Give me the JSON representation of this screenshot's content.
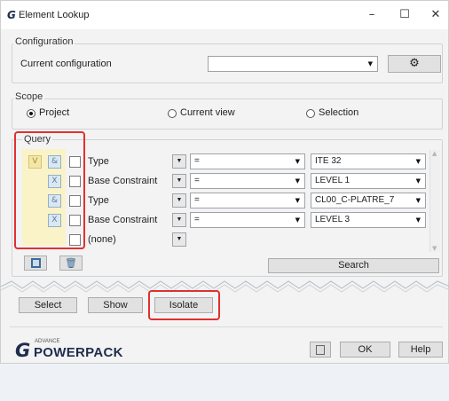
{
  "window": {
    "title": "Element Lookup",
    "app_icon": "g-logo-icon",
    "controls": {
      "minimize": "–",
      "maximize": "☐",
      "close": "✕"
    }
  },
  "configuration": {
    "group_label": "Configuration",
    "current_label": "Current configuration",
    "current_value": "",
    "settings_icon": "gear-icon"
  },
  "scope": {
    "group_label": "Scope",
    "options": [
      "Project",
      "Current view",
      "Selection"
    ],
    "selected": "Project"
  },
  "query": {
    "group_label": "Query",
    "rows": [
      {
        "op": "V",
        "op2": "&",
        "param": "Type",
        "operator": "=",
        "value": "ITE 32"
      },
      {
        "op": "",
        "op2": "X",
        "param": "Base Constraint",
        "operator": "=",
        "value": "LEVEL 1"
      },
      {
        "op": "",
        "op2": "&",
        "param": "Type",
        "operator": "=",
        "value": "CL00_C-PLATRE_7"
      },
      {
        "op": "",
        "op2": "X",
        "param": "Base Constraint",
        "operator": "=",
        "value": "LEVEL 3"
      },
      {
        "op": "",
        "op2": "",
        "param": "(none)",
        "operator": "",
        "value": ""
      }
    ],
    "search_label": "Search"
  },
  "actions": {
    "select": "Select",
    "show": "Show",
    "isolate": "Isolate"
  },
  "footer": {
    "brand_small": "ADVANCE",
    "brand_big": "POWERPACK",
    "ok": "OK",
    "help": "Help"
  },
  "colors": {
    "highlight": "#e03030",
    "query_bg": "#fbf3c8",
    "op_bg": "#dbe7f1"
  }
}
